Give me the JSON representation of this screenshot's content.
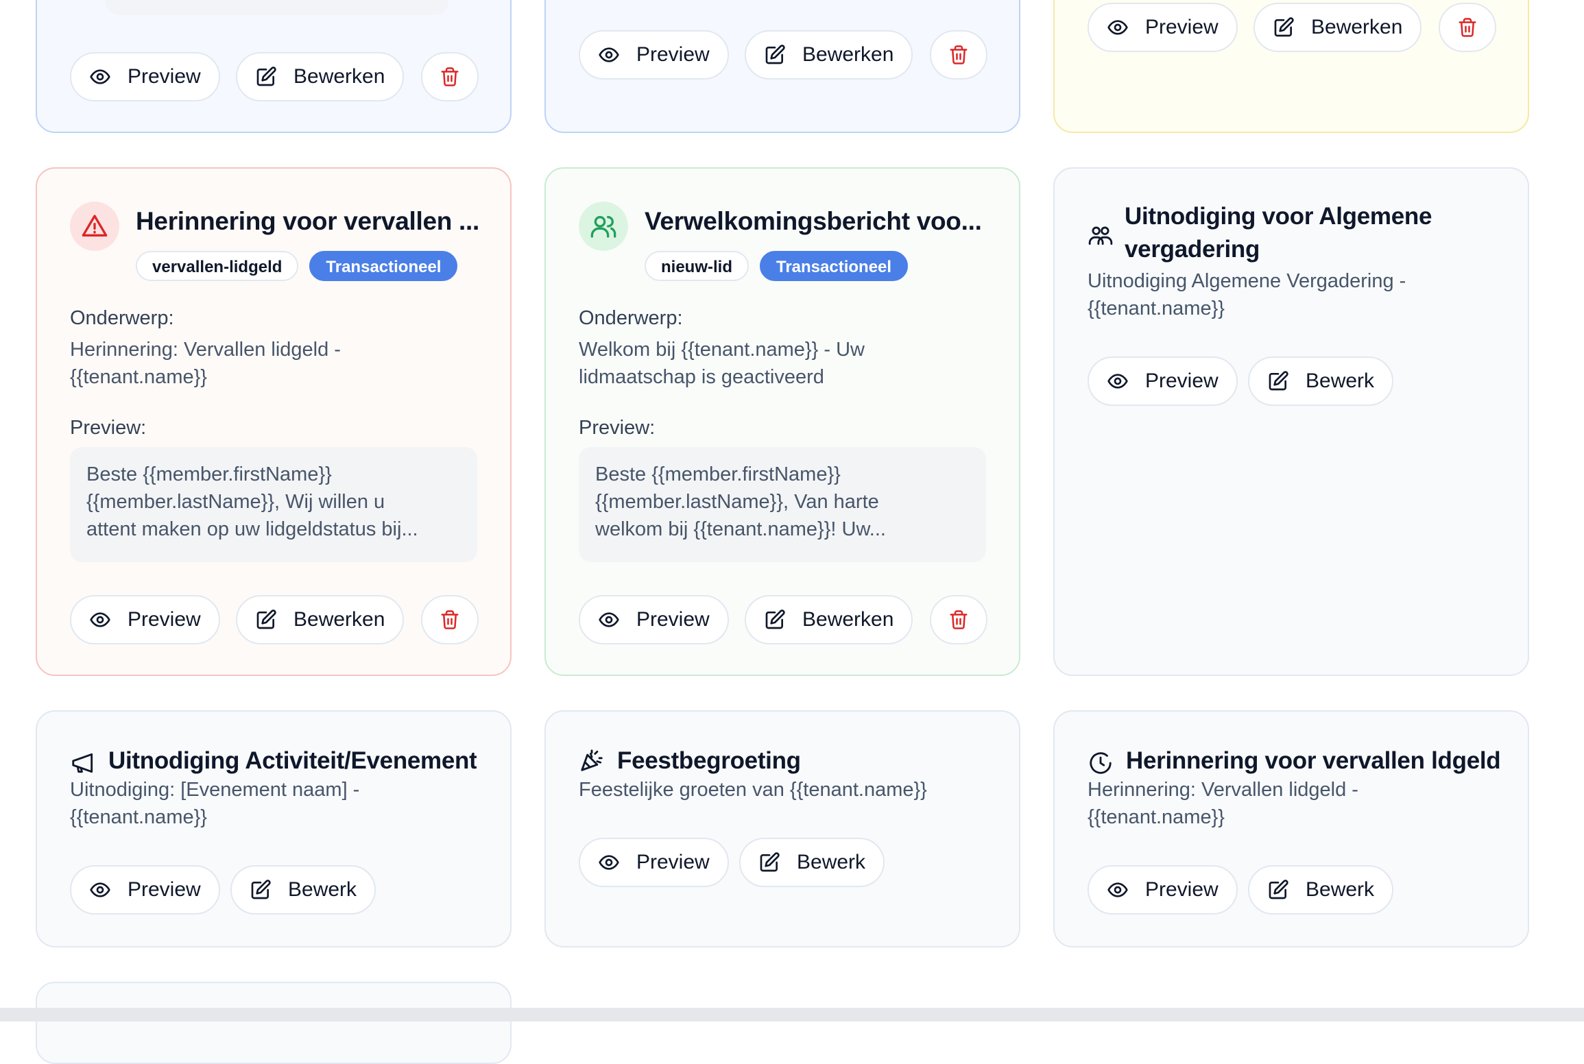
{
  "actions": {
    "preview": "Preview",
    "edit": "Bewerken",
    "edit_short": "Bewerk"
  },
  "colors": {
    "primary_tag": "#4a7fe8",
    "danger": "#dc2626",
    "success": "#22a05b"
  },
  "cards": {
    "c1": {
      "variant": "blue"
    },
    "c2": {
      "variant": "blue"
    },
    "c3": {
      "variant": "yellow"
    },
    "c4": {
      "icon": "warning-triangle-icon",
      "title": "Herinnering voor vervallen ...",
      "tags": [
        "vervallen-lidgeld",
        "Transactioneel"
      ],
      "subject_label": "Onderwerp:",
      "subject_lines": [
        "Herinnering: Vervallen lidgeld -",
        "{{tenant.name}}"
      ],
      "preview_label": "Preview:",
      "preview_lines": [
        "Beste {{member.firstName}}",
        "{{member.lastName}}, Wij willen u",
        "attent maken op uw lidgeldstatus bij..."
      ]
    },
    "c5": {
      "icon": "users-icon",
      "title": "Verwelkomingsbericht voo...",
      "tags": [
        "nieuw-lid",
        "Transactioneel"
      ],
      "subject_label": "Onderwerp:",
      "subject_lines": [
        "Welkom bij {{tenant.name}} - Uw",
        "lidmaatschap is geactiveerd"
      ],
      "preview_label": "Preview:",
      "preview_lines": [
        "Beste {{member.firstName}}",
        "{{member.lastName}}, Van harte",
        "welkom bij {{tenant.name}}! Uw..."
      ]
    },
    "c6": {
      "icon": "group-icon",
      "title_lines": [
        "Uitnodiging voor Algemene",
        "vergadering"
      ],
      "subject_lines": [
        "Uitnodiging Algemene Vergadering -",
        "{{tenant.name}}"
      ]
    },
    "c7": {
      "icon": "megaphone-icon",
      "title": "Uitnodiging Activiteit/Evenement",
      "subject_lines": [
        "Uitnodiging: [Evenement naam] -",
        "{{tenant.name}}"
      ]
    },
    "c8": {
      "icon": "party-popper-icon",
      "title": "Feestbegroeting",
      "subject_lines": [
        "Feestelijke groeten van {{tenant.name}}"
      ]
    },
    "c9": {
      "icon": "clock-icon",
      "title": "Herinnering voor vervallen ldgeld",
      "subject_lines": [
        "Herinnering: Vervallen lidgeld -",
        "{{tenant.name}}"
      ]
    }
  }
}
